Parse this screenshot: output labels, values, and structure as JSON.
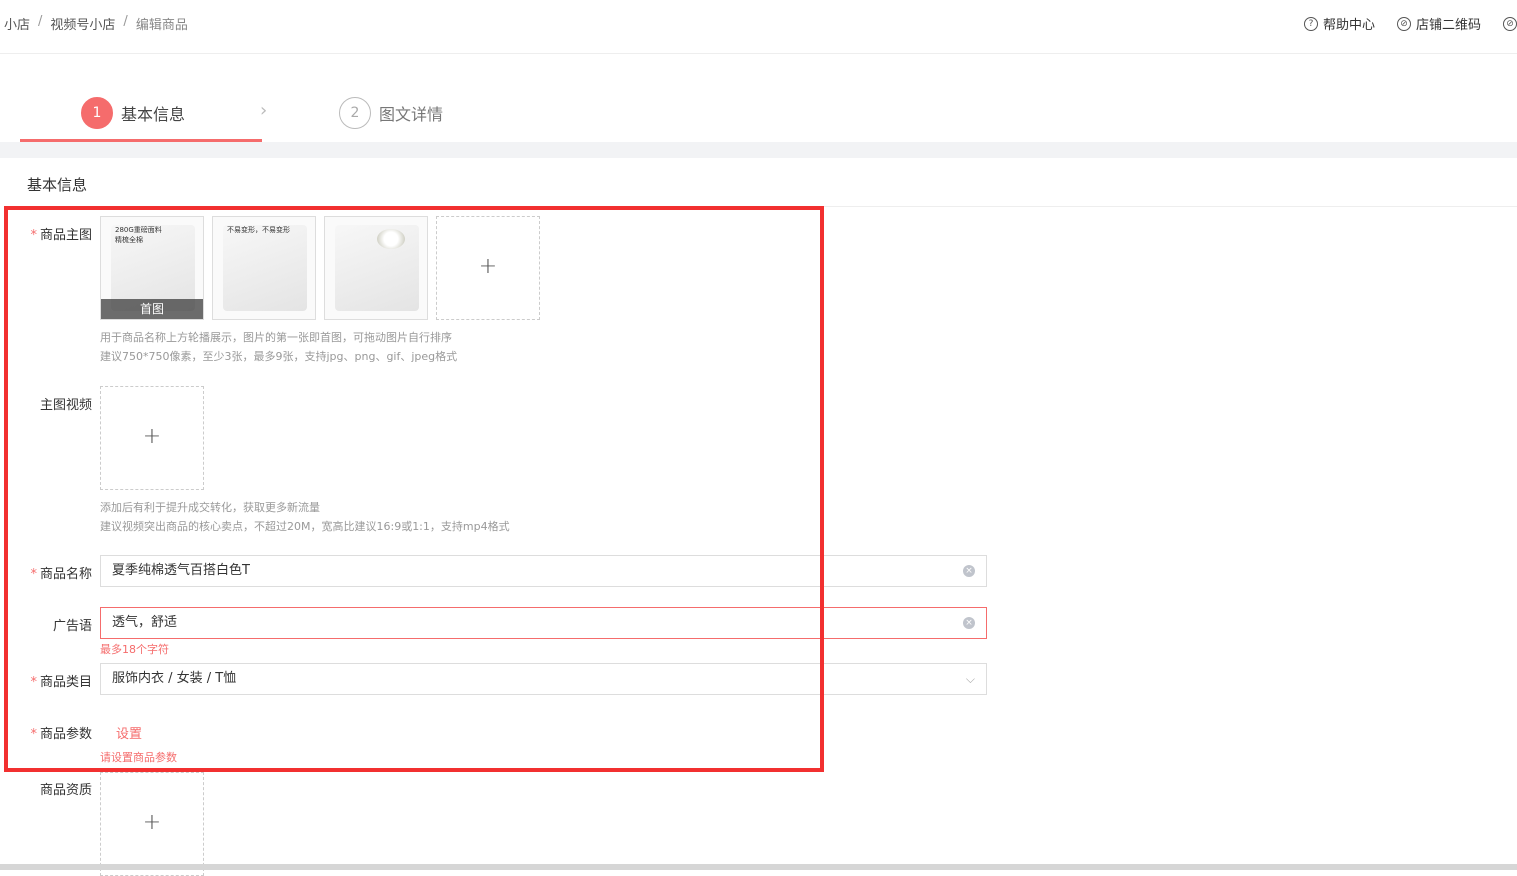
{
  "breadcrumb": {
    "item1": "小店",
    "item2": "视频号小店",
    "item3": "编辑商品",
    "sep": "/"
  },
  "top_actions": {
    "help": "帮助中心",
    "qrcode": "店铺二维码"
  },
  "steps": [
    {
      "num": "1",
      "label": "基本信息"
    },
    {
      "num": "2",
      "label": "图文详情"
    }
  ],
  "section_title": "基本信息",
  "main_images": {
    "label": "商品主图",
    "thumb1_text": "280G重磅面料\n精梳全棉",
    "thumb2_text": "不易变形，不易变形",
    "cover_label": "首图",
    "add": "+",
    "hint1": "用于商品名称上方轮播展示，图片的第一张即首图，可拖动图片自行排序",
    "hint2": "建议750*750像素，至少3张，最多9张，支持jpg、png、gif、jpeg格式"
  },
  "video": {
    "label": "主图视频",
    "add": "+",
    "hint1": "添加后有利于提升成交转化，获取更多新流量",
    "hint2": "建议视频突出商品的核心卖点，不超过20M，宽高比建议16:9或1:1，支持mp4格式"
  },
  "name": {
    "label": "商品名称",
    "value": "夏季纯棉透气百搭白色T"
  },
  "slogan": {
    "label": "广告语",
    "value": "透气，舒适",
    "error": "最多18个字符"
  },
  "category": {
    "label": "商品类目",
    "value": "服饰内衣 / 女装 / T恤"
  },
  "params": {
    "label": "商品参数",
    "link": "设置",
    "error": "请设置商品参数"
  },
  "qualification": {
    "label": "商品资质",
    "add": "+"
  },
  "required_mark": "*",
  "colors": {
    "accent": "#f56c6c",
    "highlight": "#f23030"
  }
}
